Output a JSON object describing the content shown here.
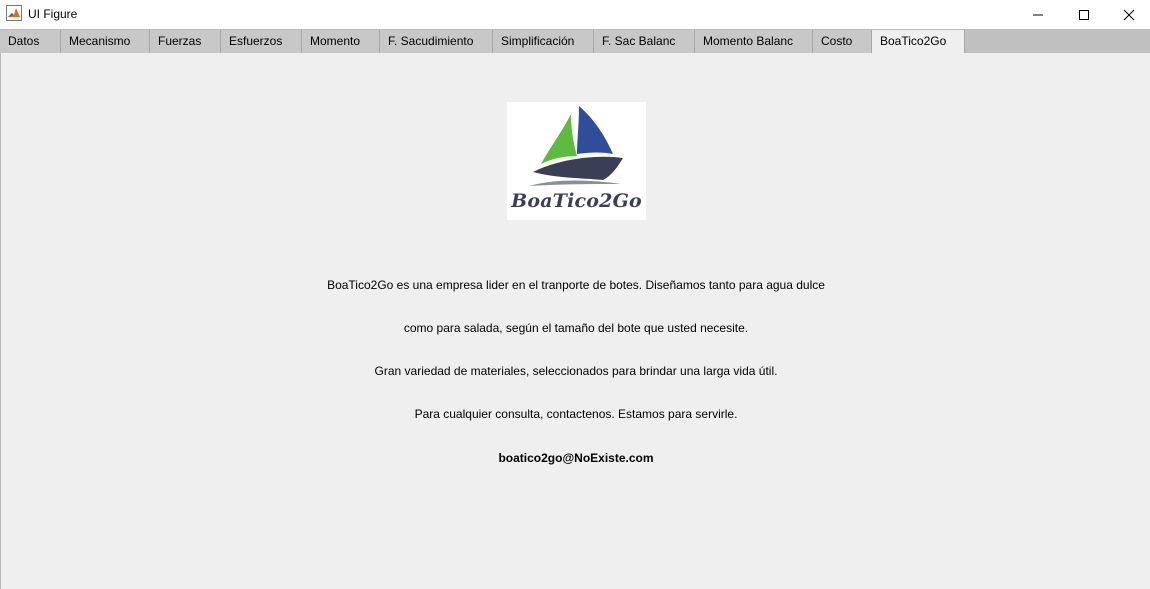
{
  "window": {
    "title": "UI Figure",
    "app_icon": "matlab-icon"
  },
  "window_controls": {
    "minimize_icon": "minimize-icon",
    "maximize_icon": "maximize-icon",
    "close_icon": "close-icon"
  },
  "tabs": [
    {
      "label": "Datos"
    },
    {
      "label": "Mecanismo"
    },
    {
      "label": "Fuerzas"
    },
    {
      "label": "Esfuerzos"
    },
    {
      "label": "Momento"
    },
    {
      "label": "F. Sacudimiento"
    },
    {
      "label": "Simplificación"
    },
    {
      "label": "F. Sac Balanc"
    },
    {
      "label": "Momento Balanc"
    },
    {
      "label": "Costo"
    },
    {
      "label": "BoaTico2Go"
    }
  ],
  "active_tab": "BoaTico2Go",
  "content": {
    "logo_text": "BoaTico2Go",
    "lines": [
      "BoaTico2Go es una empresa lider en el tranporte de botes. Diseñamos tanto para agua dulce",
      "como para salada, según el tamaño del bote que usted necesite.",
      "Gran variedad de materiales, seleccionados para brindar una larga vida útil.",
      "Para cualquier consulta, contactenos. Estamos para servirle."
    ],
    "email": "boatico2go@NoExiste.com"
  },
  "colors": {
    "panel_bg": "#efefef",
    "tabstrip_bg": "#c0c0c0",
    "logo_green": "#5dbb3f",
    "logo_blue": "#2f4d9a",
    "logo_hull": "#3a3f55"
  }
}
